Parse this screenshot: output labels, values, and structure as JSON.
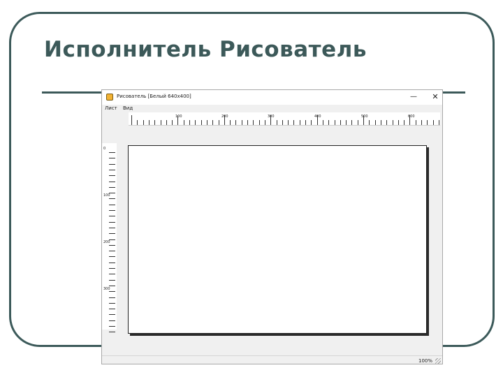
{
  "slide": {
    "title": "Исполнитель Рисователь",
    "frame_color": "#3c5959"
  },
  "app_window": {
    "title": "Рисователь [Белый 640x400]",
    "icon": "painter-app-icon",
    "controls": {
      "minimize": "—",
      "close": "✕"
    },
    "menu": [
      "Лист",
      "Вид"
    ],
    "ruler_top_labels": [
      "100",
      "200",
      "300",
      "400",
      "500",
      "600"
    ],
    "ruler_left_labels": [
      "0",
      "100",
      "200",
      "300"
    ],
    "zoom": "100%"
  }
}
